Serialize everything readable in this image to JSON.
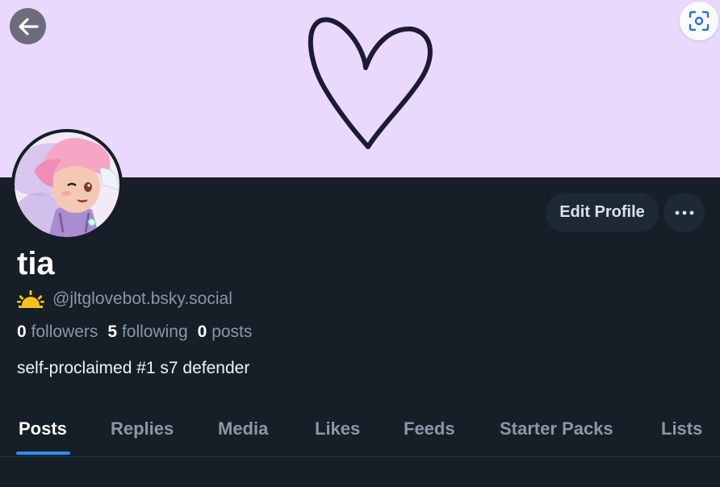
{
  "profile": {
    "display_name": "tia",
    "handle": "@jltglovebot.bsky.social",
    "handle_emoji_icon": "sunrise-icon",
    "bio": "self-proclaimed #1 s7 defender",
    "stats": {
      "followers_count": "0",
      "followers_label": "followers",
      "following_count": "5",
      "following_label": "following",
      "posts_count": "0",
      "posts_label": "posts"
    }
  },
  "actions": {
    "edit_profile": "Edit Profile",
    "more_icon": "ellipsis-icon",
    "back_icon": "arrow-left-icon",
    "scan_icon": "scan-icon"
  },
  "tabs": [
    {
      "label": "Posts",
      "active": true
    },
    {
      "label": "Replies",
      "active": false
    },
    {
      "label": "Media",
      "active": false
    },
    {
      "label": "Likes",
      "active": false
    },
    {
      "label": "Feeds",
      "active": false
    },
    {
      "label": "Starter Packs",
      "active": false
    },
    {
      "label": "Lists",
      "active": false
    }
  ],
  "colors": {
    "banner": "#e8d9fd",
    "background": "#161e27",
    "accent": "#2b8ef0",
    "muted_text": "#8897a8"
  }
}
